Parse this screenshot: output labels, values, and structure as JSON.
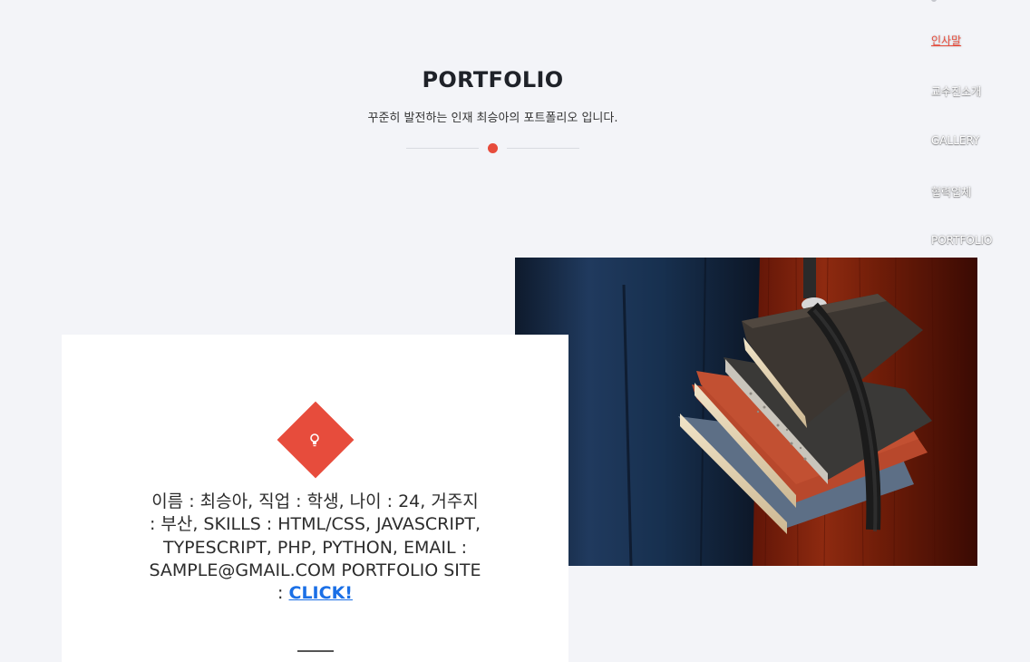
{
  "section": {
    "title": "PORTFOLIO",
    "subtitle": "꾸준히 발전하는 인재 최승아의 포트폴리오 입니다."
  },
  "nav": {
    "items": [
      {
        "label": "인사말",
        "active": true
      },
      {
        "label": "교수진소개",
        "active": false
      },
      {
        "label": "GALLERY",
        "active": false
      },
      {
        "label": "협력업체",
        "active": false
      },
      {
        "label": "PORTFOLIO",
        "active": false
      }
    ]
  },
  "profile": {
    "text": "이름 : 최승아, 직업 : 학생, 나이 : 24, 거주지 : 부산, SKILLS : HTML/CSS, JAVASCRIPT, TYPESCRIPT, PHP, PYTHON, EMAIL : SAMPLE@GMAIL.COM PORTFOLIO SITE : ",
    "link_label": "CLICK!",
    "icon": "lightbulb-icon"
  },
  "photo": {
    "subject": "books-strap-photo"
  },
  "colors": {
    "accent": "#e74c3c",
    "background": "#f3f4f8",
    "link": "#1a6fe6"
  }
}
